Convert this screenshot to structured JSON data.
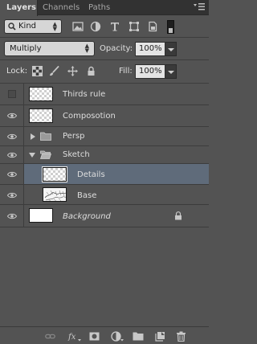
{
  "tabs": [
    {
      "label": "Layers"
    },
    {
      "label": "Channels"
    },
    {
      "label": "Paths"
    }
  ],
  "filter": {
    "kind_label": "Kind",
    "icons": [
      "image-filter-icon",
      "adjustment-filter-icon",
      "type-filter-icon",
      "shape-filter-icon",
      "smart-object-filter-icon"
    ]
  },
  "blend": {
    "mode": "Multiply",
    "opacity_label": "Opacity:",
    "opacity_value": "100%"
  },
  "lock": {
    "label": "Lock:",
    "fill_label": "Fill:",
    "fill_value": "100%"
  },
  "layers": [
    {
      "name": "Thirds rule",
      "visible": false
    },
    {
      "name": "Composotion",
      "visible": true
    },
    {
      "name": "Persp",
      "visible": true,
      "group": true,
      "expanded": false
    },
    {
      "name": "Sketch",
      "visible": true,
      "group": true,
      "expanded": true
    },
    {
      "name": "Details",
      "visible": true,
      "selected": true
    },
    {
      "name": "Base",
      "visible": true
    },
    {
      "name": "Background",
      "visible": true,
      "locked": true
    }
  ],
  "colors": {
    "panel_bg": "#535353",
    "selected_row": "#5f6b7a",
    "tabbar_bg": "#323232"
  }
}
